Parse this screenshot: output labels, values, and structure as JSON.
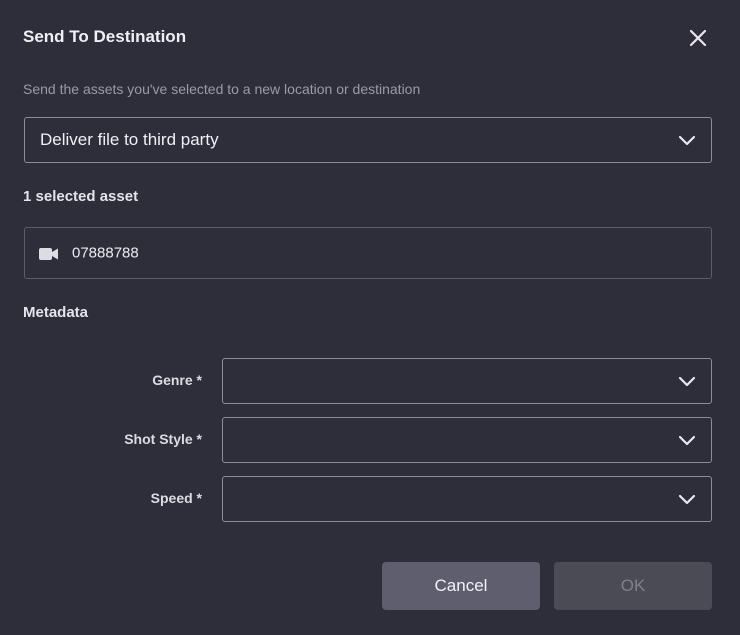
{
  "dialog": {
    "title": "Send To Destination",
    "description": "Send the assets you've selected to a new location or destination",
    "destination_select": {
      "value": "Deliver file to third party",
      "icon": "chevron-down-icon"
    },
    "assets": {
      "count_label": "1 selected asset",
      "items": [
        {
          "name": "07888788",
          "icon": "video-camera-icon"
        }
      ]
    },
    "metadata": {
      "heading": "Metadata",
      "fields": [
        {
          "label": "Genre *",
          "value": ""
        },
        {
          "label": "Shot Style *",
          "value": ""
        },
        {
          "label": "Speed *",
          "value": ""
        }
      ]
    },
    "buttons": {
      "cancel": "Cancel",
      "ok": "OK"
    },
    "colors": {
      "background": "#2e2d3a",
      "cancel_button": "#5f5e6e",
      "ok_button_disabled": "#4b4b55"
    }
  }
}
